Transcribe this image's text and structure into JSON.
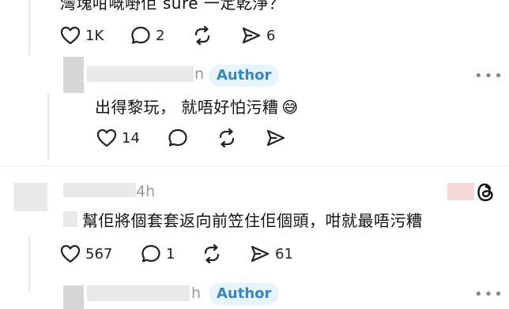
{
  "post": {
    "text_partial": "灣塊咁嘅嘢佢 sure 一定乾淨？",
    "actions": {
      "likes": "1K",
      "comments": "2",
      "shares": "6"
    }
  },
  "reply1": {
    "author_suffix": "n",
    "badge": "Author",
    "text": "出得黎玩，  就唔好怕污糟",
    "emoji": "😅",
    "actions": {
      "likes": "14"
    }
  },
  "comment2": {
    "time_suffix": "4h",
    "text": "幫佢將個套套返向前笠住佢個頭，咁就最唔污糟",
    "actions": {
      "likes": "567",
      "comments": "1",
      "shares": "61"
    }
  },
  "reply2": {
    "author_suffix": "h",
    "badge": "Author"
  },
  "more_label": "•••",
  "colors": {
    "badge_bg": "#e8f4fb",
    "badge_text": "#3b86b8"
  }
}
